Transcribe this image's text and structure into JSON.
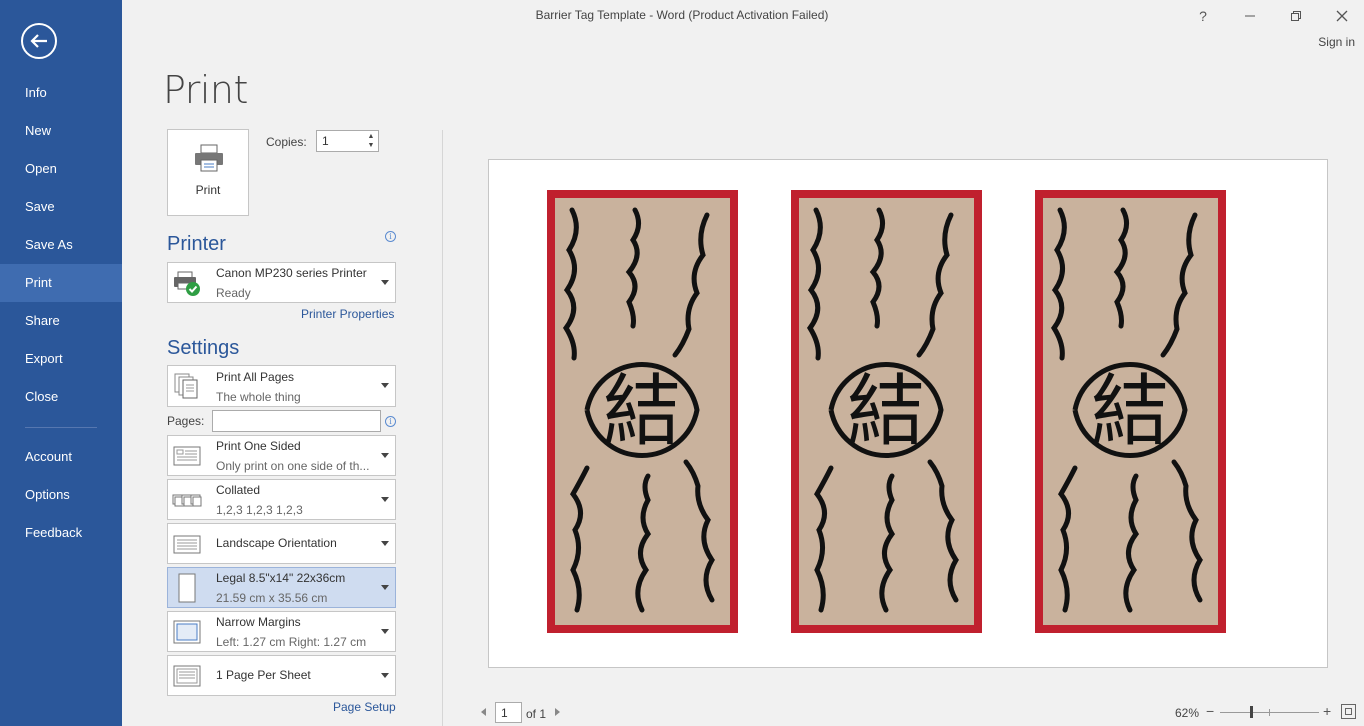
{
  "window": {
    "title": "Barrier Tag Template - Word (Product Activation Failed)",
    "help": "?",
    "sign_in": "Sign in"
  },
  "sidebar": {
    "items": [
      {
        "label": "Info"
      },
      {
        "label": "New"
      },
      {
        "label": "Open"
      },
      {
        "label": "Save"
      },
      {
        "label": "Save As"
      },
      {
        "label": "Print",
        "active": true
      },
      {
        "label": "Share"
      },
      {
        "label": "Export"
      },
      {
        "label": "Close"
      },
      {
        "label": "Account"
      },
      {
        "label": "Options"
      },
      {
        "label": "Feedback"
      }
    ]
  },
  "page_title": "Print",
  "print_button": {
    "label": "Print"
  },
  "copies": {
    "label": "Copies:",
    "value": "1"
  },
  "printer": {
    "heading": "Printer",
    "name": "Canon MP230 series Printer",
    "status": "Ready",
    "properties_link": "Printer Properties"
  },
  "settings": {
    "heading": "Settings",
    "print_range": {
      "title": "Print All Pages",
      "subtitle": "The whole thing"
    },
    "pages_label": "Pages:",
    "pages_value": "",
    "sides": {
      "title": "Print One Sided",
      "subtitle": "Only print on one side of th..."
    },
    "collation": {
      "title": "Collated",
      "subtitle": "1,2,3    1,2,3    1,2,3"
    },
    "orientation": {
      "title": "Landscape Orientation"
    },
    "paper": {
      "title": "Legal 8.5\"x14\" 22x36cm",
      "subtitle": "21.59 cm x 35.56 cm"
    },
    "margins": {
      "title": "Narrow Margins",
      "subtitle": "Left:  1.27 cm    Right:  1.27 cm"
    },
    "pages_per_sheet": {
      "title": "1 Page Per Sheet"
    },
    "page_setup_link": "Page Setup"
  },
  "preview": {
    "tag_count": 3,
    "tag_glyph": "結",
    "tag_border_color": "#c0202e",
    "tag_paper_color": "#c9b29d"
  },
  "pager": {
    "current": "1",
    "of_label": "of 1"
  },
  "zoom": {
    "percent": "62%",
    "minus": "−",
    "plus": "+"
  },
  "colors": {
    "accent": "#2b579a",
    "sidebar_active": "#3f6cb0",
    "selected_dropdown": "#cfdcf0"
  }
}
